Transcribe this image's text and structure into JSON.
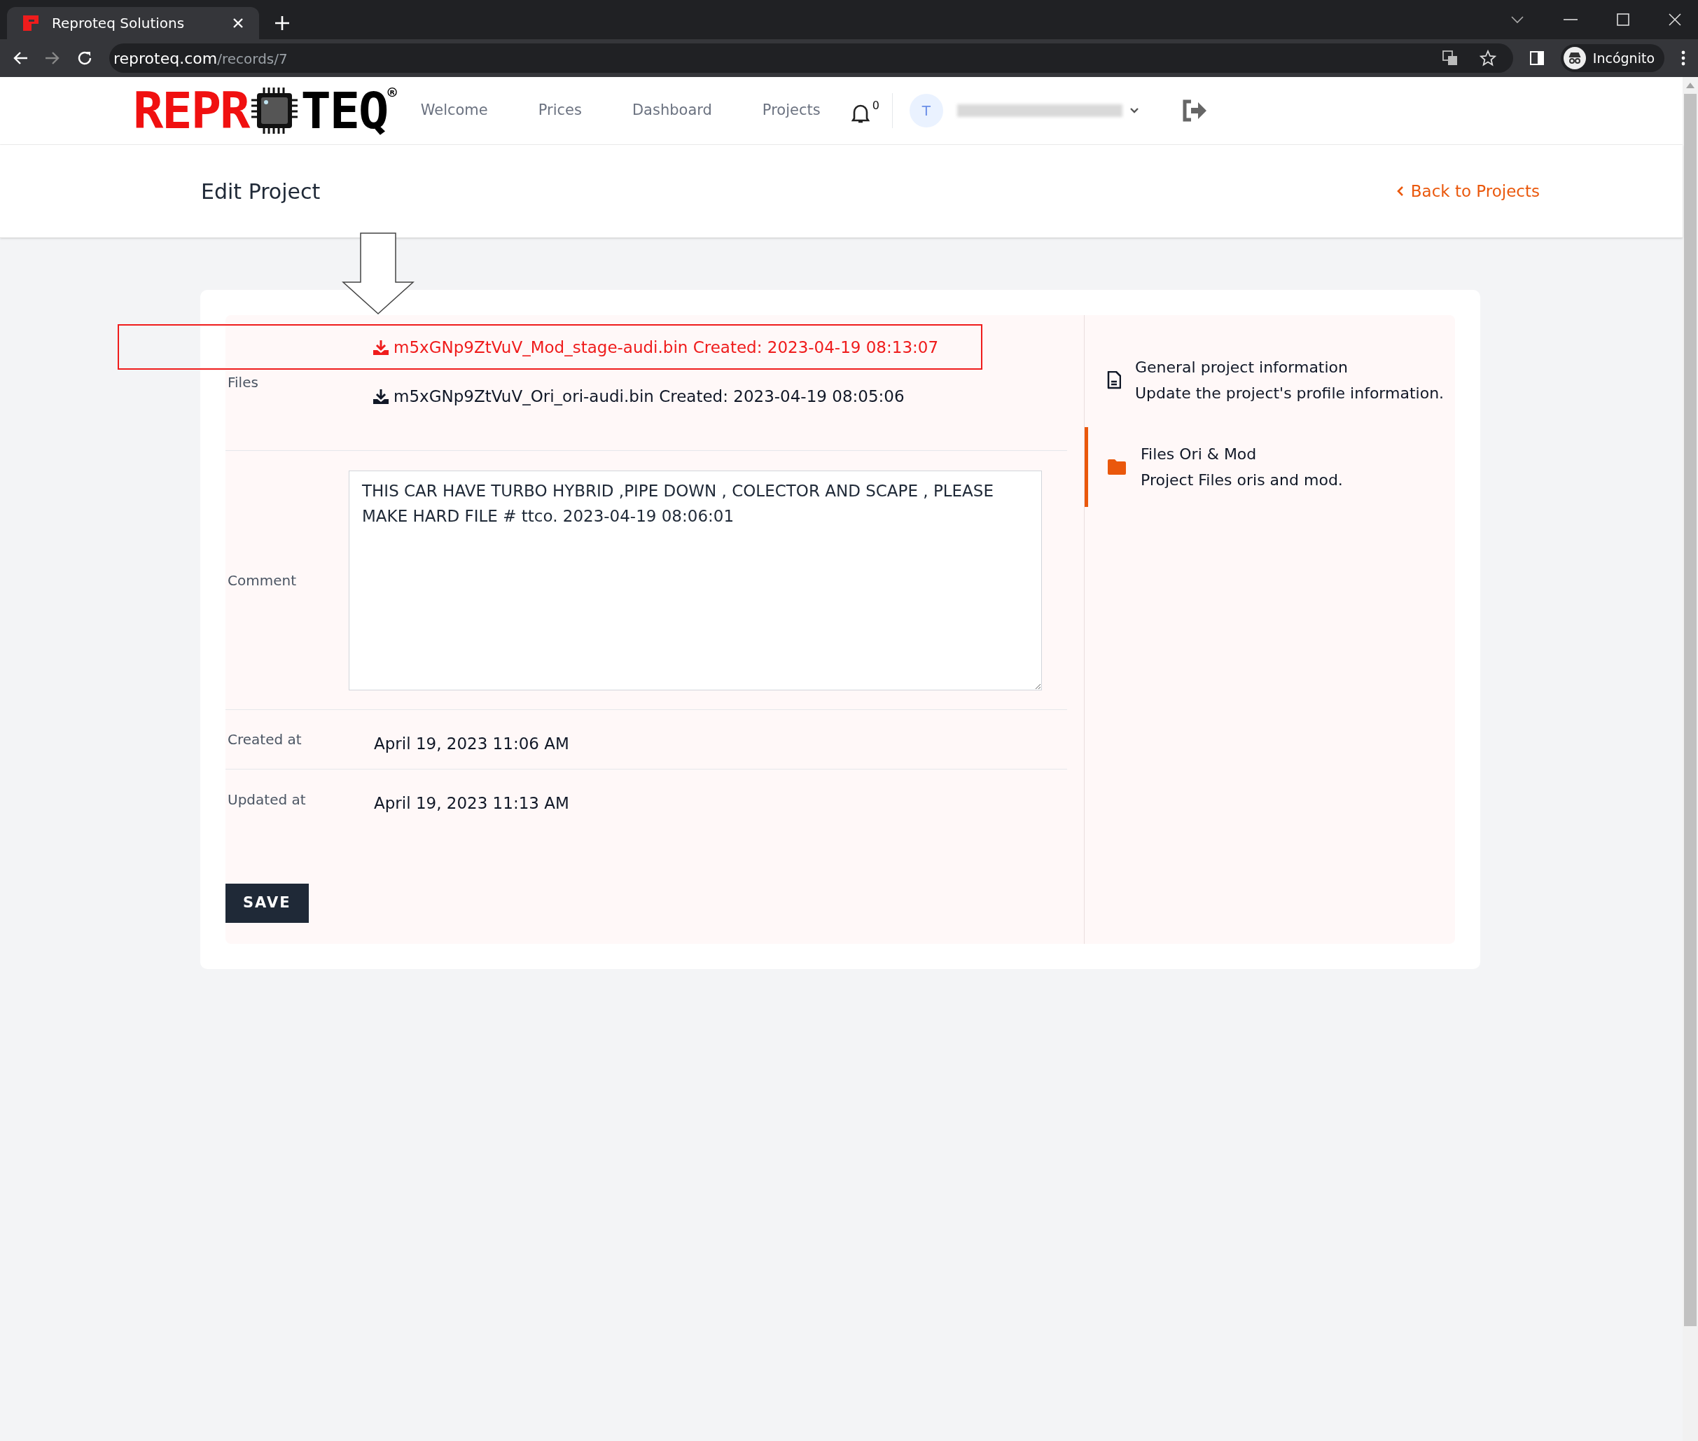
{
  "browser": {
    "tab_title": "Reproteq Solutions",
    "url_host": "reproteq.com",
    "url_path": "/records/7",
    "profile_label": "Incógnito"
  },
  "logo": {
    "left": "REPR",
    "right": "TEQ",
    "mark": "®"
  },
  "nav": {
    "links": [
      "Welcome",
      "Prices",
      "Dashboard",
      "Projects"
    ],
    "notification_count": "0",
    "avatar_initial": "T"
  },
  "page": {
    "title": "Edit Project",
    "back_link": "Back to Projects"
  },
  "form": {
    "files_label": "Files",
    "files": [
      {
        "text": "m5xGNp9ZtVuV_Mod_stage-audi.bin Created: 2023-04-19 08:13:07",
        "highlighted": true
      },
      {
        "text": "m5xGNp9ZtVuV_Ori_ori-audi.bin Created: 2023-04-19 08:05:06",
        "highlighted": false
      }
    ],
    "comment_label": "Comment",
    "comment_value": "THIS CAR HAVE TURBO HYBRID ,PIPE DOWN , COLECTOR AND SCAPE , PLEASE MAKE HARD FILE # ttco. 2023-04-19 08:06:01",
    "created_label": "Created at",
    "created_value": "April 19, 2023 11:06 AM",
    "updated_label": "Updated at",
    "updated_value": "April 19, 2023 11:13 AM",
    "save_button": "SAVE"
  },
  "side_nav": [
    {
      "kind": "document",
      "title": "General project information",
      "subtitle": "Update the project's profile information.",
      "selected": false
    },
    {
      "kind": "folder",
      "title": "Files Ori & Mod",
      "subtitle": "Project Files oris and mod.",
      "selected": true
    }
  ]
}
